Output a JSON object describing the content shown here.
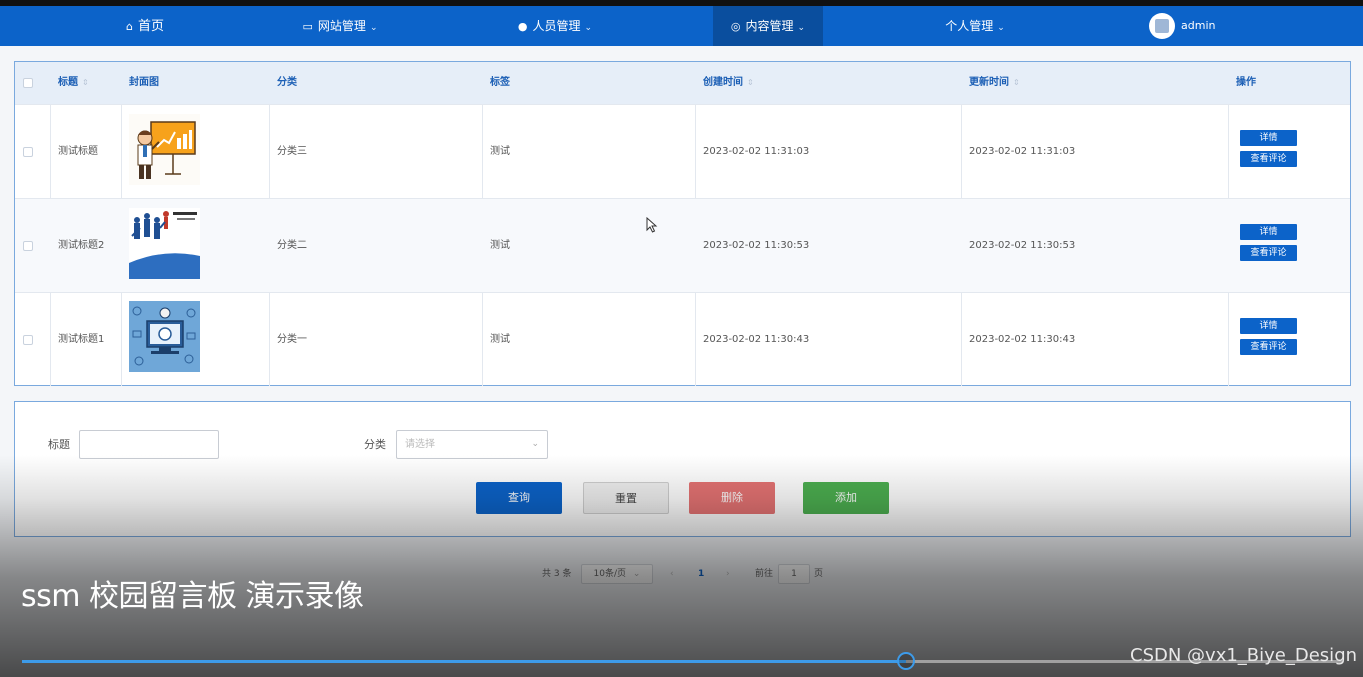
{
  "nav": {
    "home": "首页",
    "website": "网站管理",
    "people": "人员管理",
    "content": "内容管理",
    "personal": "个人管理",
    "user": "admin"
  },
  "table": {
    "headers": [
      "标题",
      "封面图",
      "分类",
      "标签",
      "创建时间",
      "更新时间",
      "操作"
    ],
    "rows": [
      {
        "title": "测试标题",
        "category": "分类三",
        "tag": "测试",
        "created": "2023-02-02 11:31:03",
        "updated": "2023-02-02 11:31:03"
      },
      {
        "title": "测试标题2",
        "category": "分类二",
        "tag": "测试",
        "created": "2023-02-02 11:30:53",
        "updated": "2023-02-02 11:30:53"
      },
      {
        "title": "测试标题1",
        "category": "分类一",
        "tag": "测试",
        "created": "2023-02-02 11:30:43",
        "updated": "2023-02-02 11:30:43"
      }
    ],
    "detail_label": "详情",
    "comments_label": "查看评论"
  },
  "search": {
    "title_label": "标题",
    "title_value": "",
    "category_label": "分类",
    "category_placeholder": "请选择",
    "query": "查询",
    "reset": "重置",
    "delete": "删除",
    "add": "添加"
  },
  "colors": {
    "primary": "#0c63c9",
    "danger": "#e57373",
    "success": "#4caf50",
    "reset": "#f0f0f0"
  },
  "pagination": {
    "total": "共 3 条",
    "page_size": "10条/页",
    "current_page": "1",
    "goto_label": "前往",
    "goto_value": "1",
    "page_unit": "页"
  },
  "video": {
    "caption": "ssm 校园留言板 演示录像",
    "watermark": "CSDN @vx1_Biye_Design",
    "progress": 0.67
  }
}
